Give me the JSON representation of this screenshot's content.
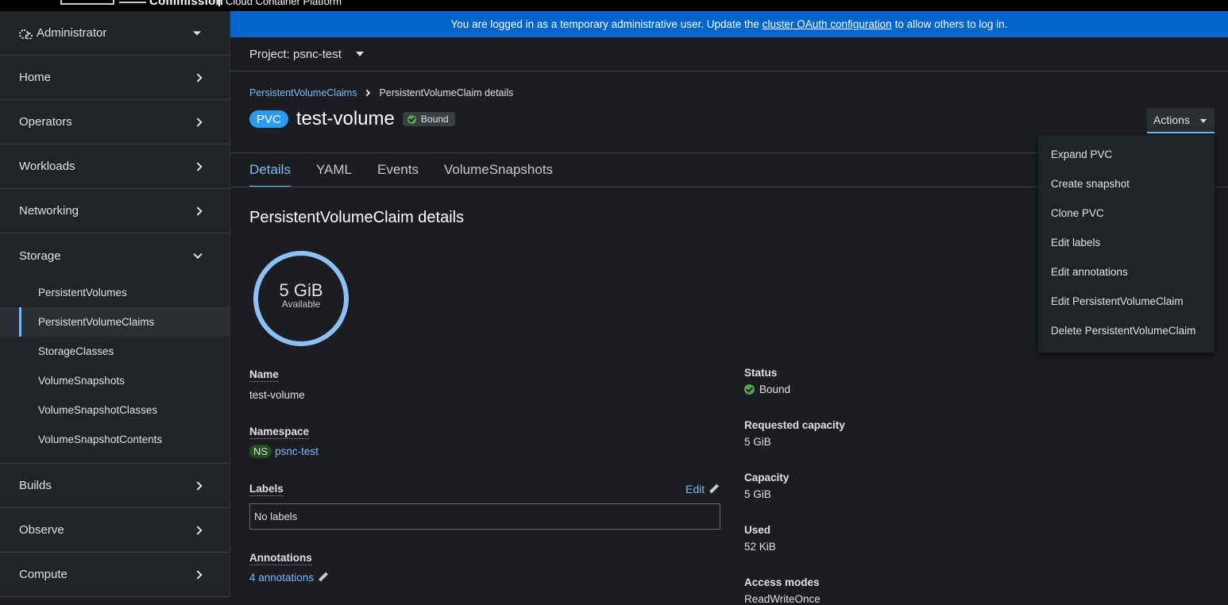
{
  "masthead": {
    "brand": "Commission",
    "subtitle": "Cloud Container Platform"
  },
  "banner": {
    "before": "You are logged in as a temporary administrative user. Update the",
    "link": "cluster OAuth configuration",
    "after": "to allow others to log in."
  },
  "sidebar": {
    "perspective": "Administrator",
    "sections": {
      "home": "Home",
      "operators": "Operators",
      "workloads": "Workloads",
      "networking": "Networking",
      "storage": "Storage",
      "builds": "Builds",
      "observe": "Observe",
      "compute": "Compute"
    },
    "storage_items": [
      "PersistentVolumes",
      "PersistentVolumeClaims",
      "StorageClasses",
      "VolumeSnapshots",
      "VolumeSnapshotClasses",
      "VolumeSnapshotContents"
    ],
    "active_item": "PersistentVolumeClaims"
  },
  "project": {
    "label": "Project: psnc-test"
  },
  "breadcrumb": {
    "parent": "PersistentVolumeClaims",
    "current": "PersistentVolumeClaim details"
  },
  "header": {
    "badge": "PVC",
    "title": "test-volume",
    "status": "Bound",
    "actions_label": "Actions"
  },
  "actions_menu": [
    "Expand PVC",
    "Create snapshot",
    "Clone PVC",
    "Edit labels",
    "Edit annotations",
    "Edit PersistentVolumeClaim",
    "Delete PersistentVolumeClaim"
  ],
  "tabs": [
    "Details",
    "YAML",
    "Events",
    "VolumeSnapshots"
  ],
  "active_tab": "Details",
  "details": {
    "section_title": "PersistentVolumeClaim details",
    "donut": {
      "value": "5 GiB",
      "label": "Available"
    },
    "name_label": "Name",
    "name_value": "test-volume",
    "namespace_label": "Namespace",
    "namespace_badge": "NS",
    "namespace_value": "psnc-test",
    "labels_label": "Labels",
    "labels_edit": "Edit",
    "labels_value": "No labels",
    "annotations_label": "Annotations",
    "annotations_value": "4 annotations",
    "status_label": "Status",
    "status_value": "Bound",
    "requested_label": "Requested capacity",
    "requested_value": "5 GiB",
    "capacity_label": "Capacity",
    "capacity_value": "5 GiB",
    "used_label": "Used",
    "used_value": "52 KiB",
    "access_label": "Access modes",
    "access_value": "ReadWriteOnce"
  },
  "colors": {
    "accent": "#73bcf7",
    "banner": "#0066cc",
    "pvc_badge": "#2b9af3",
    "status_ok": "#5ba352",
    "donut": "#8bc1f7"
  }
}
